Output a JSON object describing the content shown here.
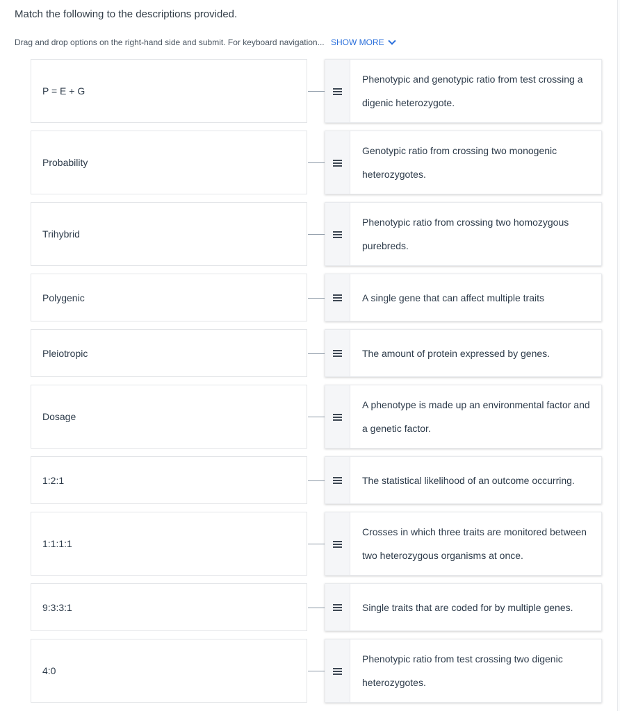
{
  "question": {
    "title": "Match the following to the descriptions provided.",
    "instructions": "Drag and drop options on the right-hand side and submit. For keyboard navigation...",
    "show_more_label": "SHOW MORE",
    "show_more_icon": "chevron-down-icon",
    "accent_color": "#2a6fdb"
  },
  "handle_icon": "drag-handle-icon",
  "pairs": [
    {
      "term": "P = E + G",
      "description": "Phenotypic and genotypic ratio from test crossing a digenic heterozygote."
    },
    {
      "term": "Probability",
      "description": "Genotypic ratio from crossing two monogenic heterozygotes."
    },
    {
      "term": "Trihybrid",
      "description": "Phenotypic ratio from crossing two homozygous purebreds."
    },
    {
      "term": "Polygenic",
      "description": "A single gene that can affect multiple traits"
    },
    {
      "term": "Pleiotropic",
      "description": "The amount of protein expressed by genes."
    },
    {
      "term": "Dosage",
      "description": "A phenotype is made up an environmental factor and a genetic factor."
    },
    {
      "term": "1:2:1",
      "description": "The statistical likelihood of an outcome occurring."
    },
    {
      "term": "1:1:1:1",
      "description": "Crosses in which three traits are monitored between two heterozygous organisms at once."
    },
    {
      "term": "9:3:3:1",
      "description": "Single traits that are coded for by multiple genes."
    },
    {
      "term": "4:0",
      "description": "Phenotypic ratio from test crossing two digenic heterozygotes."
    }
  ]
}
